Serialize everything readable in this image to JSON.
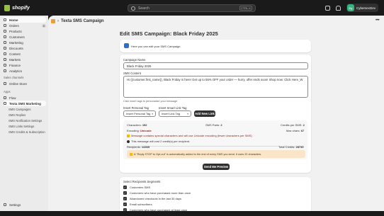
{
  "topbar": {
    "brand": "shopify",
    "search_placeholder": "Search",
    "shortcut": "CTRL K",
    "store_initials": "Cy",
    "store_name": "CybersecDev"
  },
  "sidebar": {
    "items": [
      {
        "label": "Home"
      },
      {
        "label": "Orders",
        "badge": "0"
      },
      {
        "label": "Products"
      },
      {
        "label": "Customers"
      },
      {
        "label": "Marketing"
      },
      {
        "label": "Discounts"
      },
      {
        "label": "Content"
      },
      {
        "label": "Markets"
      },
      {
        "label": "Finance"
      },
      {
        "label": "Analytics"
      }
    ],
    "sales_channels_label": "Sales channels",
    "online_store": "Online Store",
    "apps_label": "Apps",
    "flow": "Flow",
    "app_name": "Texta SMS Marketing",
    "sub_items": [
      {
        "label": "SMS Campaigns"
      },
      {
        "label": "SMS Replies"
      },
      {
        "label": "SMS Notification Settings"
      },
      {
        "label": "SMS Links Settings"
      },
      {
        "label": "SMS Credits & Subscription"
      }
    ],
    "settings": "Settings"
  },
  "page": {
    "app_title": "Texta SMS Campaign",
    "heading": "Edit SMS Campaign: Black Friday 2025",
    "info_text": "Here you can edit your SMS Campaign.",
    "campaign_name_label": "Campaign Name",
    "campaign_name_value": "Black Friday 2025",
    "sms_content_label": "SMS Content",
    "sms_content_value": "Hi {{customer.first_name}}, Black Friday is here! Get up to 55% OFF your order — hurry, offer ends soon! Shop now: Click Here_W",
    "content_hint": "Click insert tags to personalize your message",
    "personal_tag_label": "Insert Personal Tag",
    "personal_tag_value": "Insert Personal Tag",
    "link_tag_label": "Insert Smart Link Tag",
    "link_tag_value": "Insert Link Tag",
    "add_link_button": "Add New Link",
    "stats": {
      "characters_label": "Characters:",
      "characters_value": "152",
      "parts_label": "SMS Parts:",
      "parts_value": "2",
      "credits_label": "Credits per SMS:",
      "credits_value": "2",
      "encoding_label": "Encoding:",
      "encoding_value": "Unicode",
      "max_chars_label": "Max chars:",
      "max_chars_value": "67",
      "warning": "Message contains special characters and will use Unicode encoding (fewer characters per SMS)",
      "cost_note": "This message will cost 2 credit(s) per recipient.",
      "recipients_label": "Recipients:",
      "recipients_value": "14365",
      "total_credits_label": "Total Credits:",
      "total_credits_value": "28730"
    },
    "stop_note": "A \"Reply STOP to Opt-out\" is automatically added to the end of every SMS you send. It uses 22 characters.",
    "preview_button": "Send Me Preview",
    "segments_label": "Select Recipients Segments",
    "segments": [
      {
        "label": "Customers SMS"
      },
      {
        "label": "Customers who have purchased more than once"
      },
      {
        "label": "Abandoned checkouts in the last 30 days"
      },
      {
        "label": "Email subscribers"
      },
      {
        "label": "Customers who have purchased at least once"
      }
    ]
  }
}
